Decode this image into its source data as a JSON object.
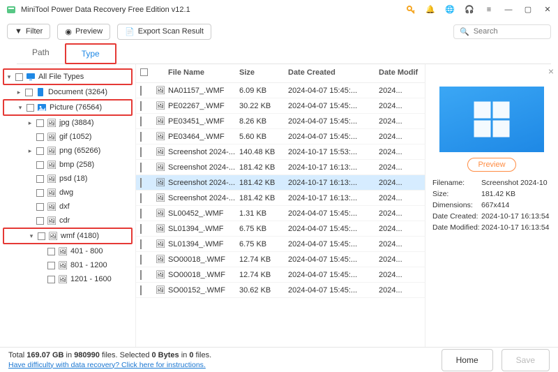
{
  "app": {
    "title": "MiniTool Power Data Recovery Free Edition v12.1"
  },
  "toolbar": {
    "filter": "Filter",
    "preview": "Preview",
    "export": "Export Scan Result",
    "search_placeholder": "Search"
  },
  "tabs": {
    "path": "Path",
    "type": "Type"
  },
  "tree": {
    "allfiletypes": "All File Types",
    "document": "Document (3264)",
    "picture": "Picture (76564)",
    "jpg": "jpg (3884)",
    "gif": "gif (1052)",
    "png": "png (65266)",
    "bmp": "bmp (258)",
    "psd": "psd (18)",
    "dwg": "dwg",
    "dxf": "dxf",
    "cdr": "cdr",
    "wmf": "wmf (4180)",
    "r1": "401 - 800",
    "r2": "801 - 1200",
    "r3": "1201 - 1600"
  },
  "headers": {
    "name": "File Name",
    "size": "Size",
    "created": "Date Created",
    "modified": "Date Modif"
  },
  "files": [
    {
      "name": "NA01157_.WMF",
      "size": "6.09 KB",
      "created": "2024-04-07 15:45:...",
      "modified": "2024..."
    },
    {
      "name": "PE02267_.WMF",
      "size": "30.22 KB",
      "created": "2024-04-07 15:45:...",
      "modified": "2024..."
    },
    {
      "name": "PE03451_.WMF",
      "size": "8.26 KB",
      "created": "2024-04-07 15:45:...",
      "modified": "2024..."
    },
    {
      "name": "PE03464_.WMF",
      "size": "5.60 KB",
      "created": "2024-04-07 15:45:...",
      "modified": "2024..."
    },
    {
      "name": "Screenshot 2024-...",
      "size": "140.48 KB",
      "created": "2024-10-17 15:53:...",
      "modified": "2024..."
    },
    {
      "name": "Screenshot 2024-...",
      "size": "181.42 KB",
      "created": "2024-10-17 16:13:...",
      "modified": "2024..."
    },
    {
      "name": "Screenshot 2024-...",
      "size": "181.42 KB",
      "created": "2024-10-17 16:13:...",
      "modified": "2024...",
      "selected": true
    },
    {
      "name": "Screenshot 2024-...",
      "size": "181.42 KB",
      "created": "2024-10-17 16:13:...",
      "modified": "2024..."
    },
    {
      "name": "SL00452_.WMF",
      "size": "1.31 KB",
      "created": "2024-04-07 15:45:...",
      "modified": "2024..."
    },
    {
      "name": "SL01394_.WMF",
      "size": "6.75 KB",
      "created": "2024-04-07 15:45:...",
      "modified": "2024..."
    },
    {
      "name": "SL01394_.WMF",
      "size": "6.75 KB",
      "created": "2024-04-07 15:45:...",
      "modified": "2024..."
    },
    {
      "name": "SO00018_.WMF",
      "size": "12.74 KB",
      "created": "2024-04-07 15:45:...",
      "modified": "2024..."
    },
    {
      "name": "SO00018_.WMF",
      "size": "12.74 KB",
      "created": "2024-04-07 15:45:...",
      "modified": "2024..."
    },
    {
      "name": "SO00152_.WMF",
      "size": "30.62 KB",
      "created": "2024-04-07 15:45:...",
      "modified": "2024..."
    }
  ],
  "detail": {
    "preview_btn": "Preview",
    "filename_k": "Filename:",
    "filename_v": "Screenshot 2024-10",
    "size_k": "Size:",
    "size_v": "181.42 KB",
    "dim_k": "Dimensions:",
    "dim_v": "667x414",
    "created_k": "Date Created:",
    "created_v": "2024-10-17 16:13:54",
    "modified_k": "Date Modified:",
    "modified_v": "2024-10-17 16:13:54"
  },
  "status": {
    "total_a": "Total ",
    "total_b": "169.07 GB",
    "total_c": " in ",
    "total_d": "980990",
    "total_e": " files.   Selected ",
    "total_f": "0 Bytes",
    "total_g": " in ",
    "total_h": "0",
    "total_i": " files.",
    "help": "Have difficulty with data recovery? Click here for instructions.",
    "home": "Home",
    "save": "Save"
  }
}
